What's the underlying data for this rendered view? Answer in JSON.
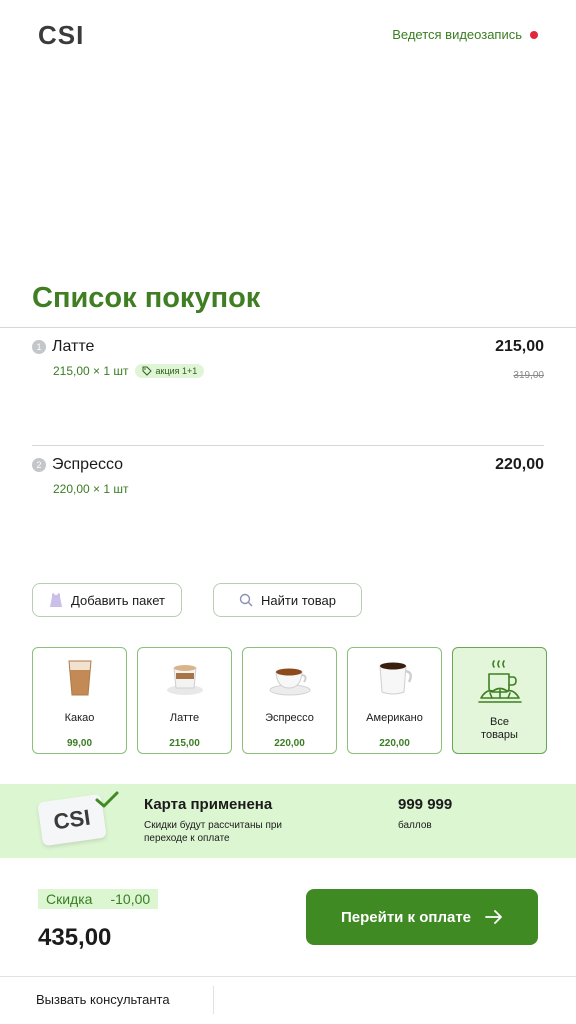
{
  "header": {
    "logo": "CSI",
    "recording_text": "Ведется видеозапись",
    "recording_color": "#e0283a"
  },
  "cart": {
    "title": "Список покупок",
    "items": [
      {
        "num": "1",
        "name": "Латте",
        "unit_price": "215,00 × 1 шт",
        "promo": "акция 1+1",
        "price": "215,00",
        "old_price": "319,00"
      },
      {
        "num": "2",
        "name": "Эспрессо",
        "unit_price": "220,00 × 1 шт",
        "price": "220,00"
      }
    ]
  },
  "actions": {
    "add_bag": "Добавить пакет",
    "find_product": "Найти товар"
  },
  "quick_products": [
    {
      "name": "Какао",
      "price": "99,00",
      "icon": "cocoa-glass-icon"
    },
    {
      "name": "Латте",
      "price": "215,00",
      "icon": "latte-cup-icon"
    },
    {
      "name": "Эспрессо",
      "price": "220,00",
      "icon": "espresso-cup-icon"
    },
    {
      "name": "Американо",
      "price": "220,00",
      "icon": "americano-cup-icon"
    }
  ],
  "all_products": {
    "label_line1": "Все",
    "label_line2": "товары"
  },
  "loyalty": {
    "card_logo": "CSI",
    "title": "Карта применена",
    "description": "Скидки будут рассчитаны при переходе к оплате",
    "points": "999 999",
    "points_label": "баллов"
  },
  "summary": {
    "discount_label": "Скидка",
    "discount_value": "-10,00",
    "total": "435,00",
    "pay_label": "Перейти к оплате"
  },
  "footer": {
    "call_consultant": "Вызвать консультанта"
  },
  "colors": {
    "accent": "#3f8a22",
    "accent_light": "#ddf6d2",
    "text_green": "#3a7d22"
  }
}
